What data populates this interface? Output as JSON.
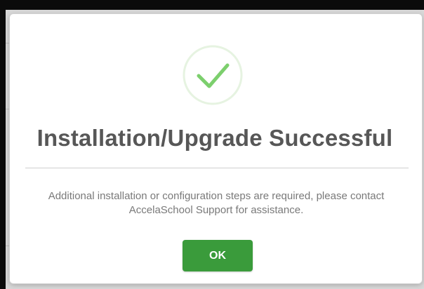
{
  "dialog": {
    "title": "Installation/Upgrade Successful",
    "message": "Additional installation or configuration steps are required, please contact AccelaSchool Support for assistance.",
    "ok_label": "OK",
    "icon": "check-circle-icon"
  },
  "colors": {
    "success_green": "#3a9b3b",
    "check_stroke": "#7ccf6d",
    "ring": "#e8f4e4",
    "title_text": "#575757",
    "body_text": "#797979"
  }
}
